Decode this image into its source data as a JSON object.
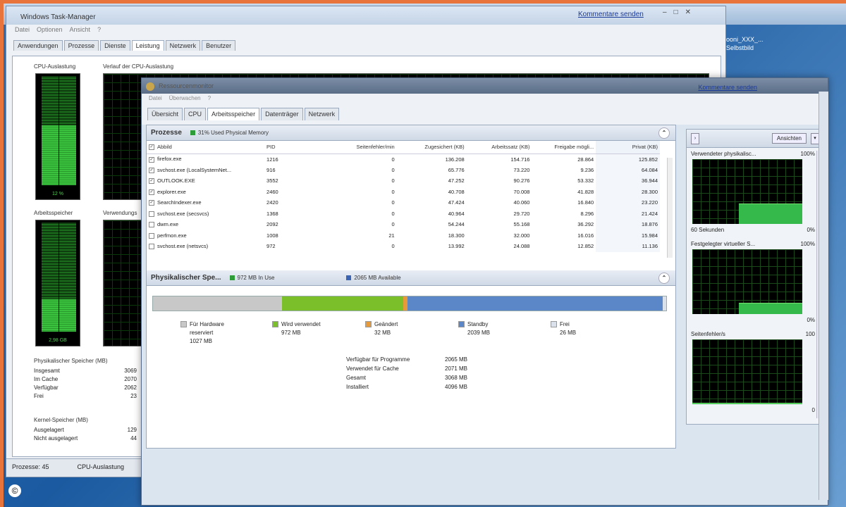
{
  "colors": {
    "accent_frame": "#e8743b",
    "hardware": "#c8c8c8",
    "in_use": "#7bbf2a",
    "modified": "#e79a3a",
    "standby": "#5b86c7",
    "free": "#dbe1ea"
  },
  "taskbar": {
    "kommentare": "Kommentare senden",
    "right_note_1": "ooni_XXX_...",
    "right_note_2": "Selbstbild"
  },
  "task_manager": {
    "title": "Windows Task-Manager",
    "menu": [
      "Datei",
      "Optionen",
      "Ansicht",
      "?"
    ],
    "tabs": [
      "Anwendungen",
      "Prozesse",
      "Dienste",
      "Leistung",
      "Netzwerk",
      "Benutzer"
    ],
    "active_tab": "Leistung",
    "cpu_label": "CPU-Auslastung",
    "cpu_history_label": "Verlauf der CPU-Auslastung",
    "cpu_value": "12 %",
    "cpu_level": 0.55,
    "mem_label": "Arbeitsspeicher",
    "mem_history_label": "Verwendungs",
    "mem_value": "2,98 GB",
    "mem_level": 0.3,
    "phys_title": "Physikalischer Speicher (MB)",
    "phys_rows": [
      {
        "label": "Insgesamt",
        "value": "3069"
      },
      {
        "label": "Im Cache",
        "value": "2070"
      },
      {
        "label": "Verfügbar",
        "value": "2062"
      },
      {
        "label": "Frei",
        "value": "23"
      }
    ],
    "kernel_title": "Kernel-Speicher (MB)",
    "kernel_rows": [
      {
        "label": "Ausgelagert",
        "value": "129"
      },
      {
        "label": "Nicht ausgelagert",
        "value": "44"
      }
    ],
    "status_processes": "Prozesse: 45",
    "status_cpu": "CPU-Auslastung"
  },
  "resource_monitor": {
    "title": "Ressourcenmonitor",
    "kommentare": "Kommentare senden",
    "menu": [
      "Datei",
      "Überwachen",
      "?"
    ],
    "tabs": [
      "Übersicht",
      "CPU",
      "Arbeitsspeicher",
      "Datenträger",
      "Netzwerk"
    ],
    "active_tab": "Arbeitsspeicher",
    "processes_panel": {
      "title": "Prozesse",
      "chip": "31% Used Physical Memory",
      "columns": [
        "Abbild",
        "PID",
        "Seitenfehler/min",
        "Zugesichert (KB)",
        "Arbeitssatz (KB)",
        "Freigabe mögli...",
        "Privat (KB)"
      ],
      "rows": [
        {
          "checked": true,
          "name": "firefox.exe",
          "pid": "1216",
          "pf": "0",
          "commit": "136.208",
          "ws": "154.716",
          "share": "28.864",
          "priv": "125.852"
        },
        {
          "checked": true,
          "name": "svchost.exe (LocalSystemNet...",
          "pid": "916",
          "pf": "0",
          "commit": "65.776",
          "ws": "73.220",
          "share": "9.236",
          "priv": "64.084"
        },
        {
          "checked": true,
          "name": "OUTLOOK.EXE",
          "pid": "3552",
          "pf": "0",
          "commit": "47.252",
          "ws": "90.276",
          "share": "53.332",
          "priv": "36.944"
        },
        {
          "checked": true,
          "name": "explorer.exe",
          "pid": "2460",
          "pf": "0",
          "commit": "40.708",
          "ws": "70.008",
          "share": "41.828",
          "priv": "28.300"
        },
        {
          "checked": true,
          "name": "SearchIndexer.exe",
          "pid": "2420",
          "pf": "0",
          "commit": "47.424",
          "ws": "40.060",
          "share": "16.840",
          "priv": "23.220"
        },
        {
          "checked": false,
          "name": "svchost.exe (secsvcs)",
          "pid": "1368",
          "pf": "0",
          "commit": "40.964",
          "ws": "29.720",
          "share": "8.296",
          "priv": "21.424"
        },
        {
          "checked": false,
          "name": "dwm.exe",
          "pid": "2092",
          "pf": "0",
          "commit": "54.244",
          "ws": "55.168",
          "share": "36.292",
          "priv": "18.876"
        },
        {
          "checked": false,
          "name": "perfmon.exe",
          "pid": "1008",
          "pf": "21",
          "commit": "18.300",
          "ws": "32.000",
          "share": "16.016",
          "priv": "15.984"
        },
        {
          "checked": false,
          "name": "svchost.exe (netsvcs)",
          "pid": "972",
          "pf": "0",
          "commit": "13.992",
          "ws": "24.088",
          "share": "12.852",
          "priv": "11.136"
        }
      ]
    },
    "phys_panel": {
      "title": "Physikalischer Spe...",
      "chip_inuse": "972 MB In Use",
      "chip_avail": "2065 MB Available",
      "bar": [
        {
          "key": "hardware",
          "mb": 1027
        },
        {
          "key": "in_use",
          "mb": 972
        },
        {
          "key": "modified",
          "mb": 32
        },
        {
          "key": "standby",
          "mb": 2039
        },
        {
          "key": "free",
          "mb": 26
        }
      ],
      "legend": [
        {
          "key": "hardware",
          "label1": "Für Hardware",
          "label2": "reserviert",
          "value": "1027 MB"
        },
        {
          "key": "in_use",
          "label1": "Wird verwendet",
          "label2": "",
          "value": "972 MB"
        },
        {
          "key": "modified",
          "label1": "Geändert",
          "label2": "",
          "value": "32 MB"
        },
        {
          "key": "standby",
          "label1": "Standby",
          "label2": "",
          "value": "2039 MB"
        },
        {
          "key": "free",
          "label1": "Frei",
          "label2": "",
          "value": "26 MB"
        }
      ],
      "summary": [
        {
          "label": "Verfügbar für Programme",
          "value": "2065 MB"
        },
        {
          "label": "Verwendet für Cache",
          "value": "2071 MB"
        },
        {
          "label": "Gesamt",
          "value": "3068 MB"
        },
        {
          "label": "Installiert",
          "value": "4096 MB"
        }
      ]
    },
    "right_pane": {
      "ansichten": "Ansichten",
      "graphs": [
        {
          "title": "Verwendeter physikalisc...",
          "max": "100%",
          "min": "0%",
          "footer": "60 Sekunden",
          "level": 0.31
        },
        {
          "title": "Festgelegter virtueller S...",
          "max": "100%",
          "min": "0%",
          "footer": "",
          "level": 0.17
        },
        {
          "title": "Seitenfehler/s",
          "max": "100",
          "min": "0",
          "footer": "",
          "level": 0.02
        }
      ]
    }
  }
}
